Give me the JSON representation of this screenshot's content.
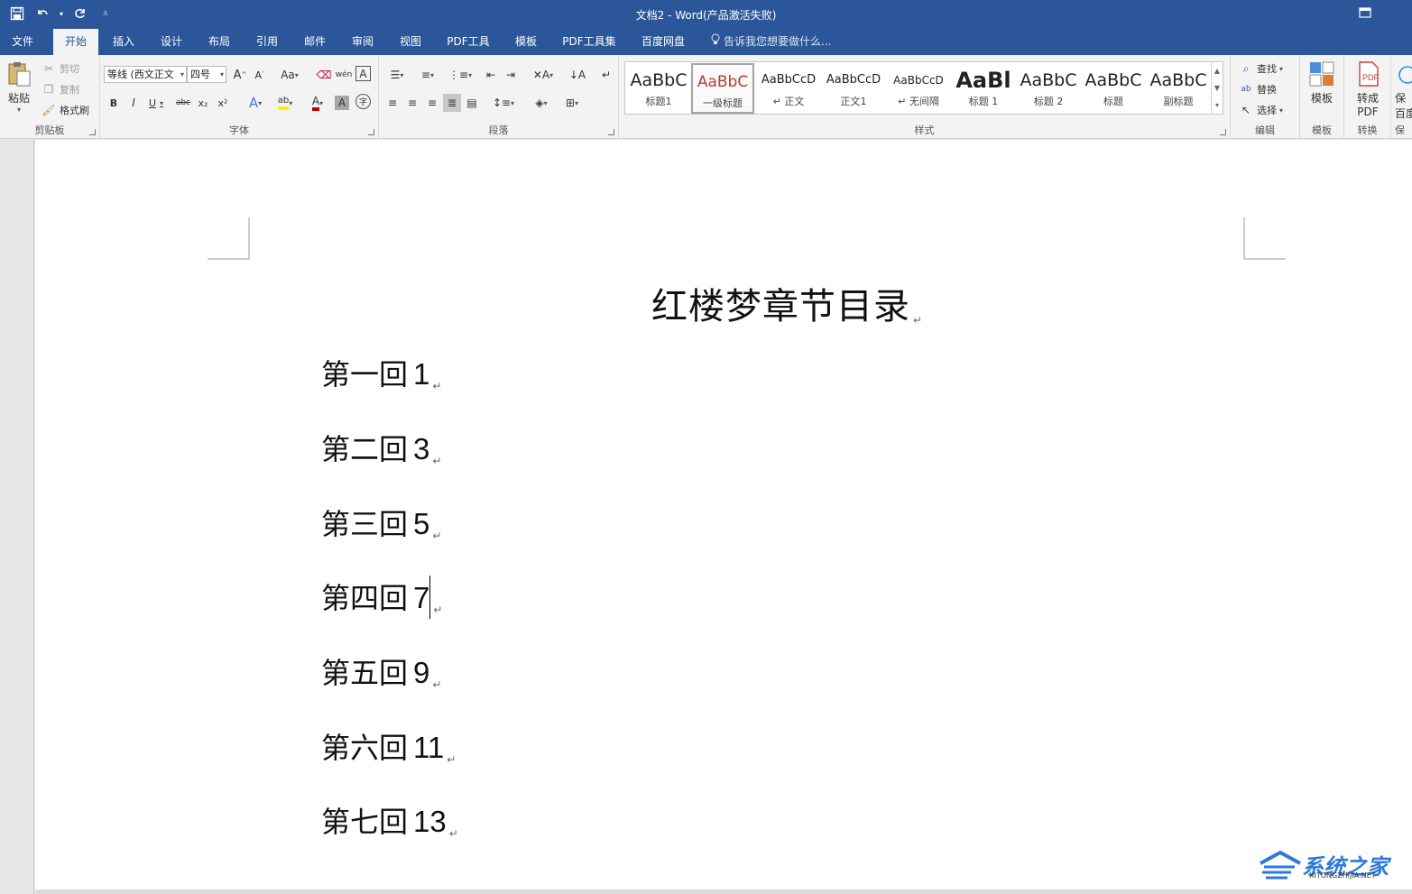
{
  "window": {
    "title": "文档2 - Word(产品激活失败)"
  },
  "tabs": [
    "文件",
    "开始",
    "插入",
    "设计",
    "布局",
    "引用",
    "邮件",
    "审阅",
    "视图",
    "PDF工具",
    "模板",
    "PDF工具集",
    "百度网盘"
  ],
  "active_tab": "开始",
  "tell_me": "告诉我您想要做什么...",
  "clipboard": {
    "paste": "粘贴",
    "cut": "剪切",
    "copy": "复制",
    "format_painter": "格式刷",
    "label": "剪贴板"
  },
  "font": {
    "name": "等线 (西文正文",
    "size": "四号",
    "label": "字体",
    "bold": "B",
    "italic": "I",
    "underline": "U",
    "strike": "abc",
    "sub": "x₂",
    "sup": "x²",
    "grow": "A",
    "shrink": "A",
    "case": "Aa",
    "pinyin": "wén",
    "border_char": "A",
    "effect": "A",
    "highlight": "ab",
    "color": "A",
    "shading": "A",
    "circle": "字"
  },
  "paragraph": {
    "label": "段落"
  },
  "styles": {
    "label": "样式",
    "items": [
      {
        "preview": "AaBbC",
        "name": "标题1"
      },
      {
        "preview": "AaBbC",
        "name": "一级标题"
      },
      {
        "preview": "AaBbCcD",
        "name": "↵ 正文"
      },
      {
        "preview": "AaBbCcD",
        "name": "正文1"
      },
      {
        "preview": "AaBbCcD",
        "name": "↵ 无间隔"
      },
      {
        "preview": "AaBl",
        "name": "标题 1"
      },
      {
        "preview": "AaBbC",
        "name": "标题 2"
      },
      {
        "preview": "AaBbC",
        "name": "标题"
      },
      {
        "preview": "AaBbC",
        "name": "副标题"
      }
    ]
  },
  "editing": {
    "find": "查找",
    "replace": "替换",
    "select": "选择",
    "label": "编辑"
  },
  "template": {
    "button": "模板",
    "label": "模板"
  },
  "convert": {
    "button_line1": "转成",
    "button_line2": "PDF",
    "label": "转换"
  },
  "save_baidu": {
    "line1": "保",
    "line2": "百度",
    "label": "保"
  },
  "document": {
    "title": "红楼梦章节目录",
    "paragraphs": [
      {
        "text": "第一回",
        "num": "1"
      },
      {
        "text": "第二回",
        "num": "3"
      },
      {
        "text": "第三回",
        "num": "5"
      },
      {
        "text": "第四回",
        "num": "7"
      },
      {
        "text": "第五回",
        "num": "9"
      },
      {
        "text": "第六回",
        "num": "11"
      },
      {
        "text": "第七回",
        "num": "13"
      }
    ],
    "paragraph_mark": "↵"
  },
  "watermark": {
    "text": "系统之家",
    "sub": "XITONGZHIJIA.NET"
  }
}
